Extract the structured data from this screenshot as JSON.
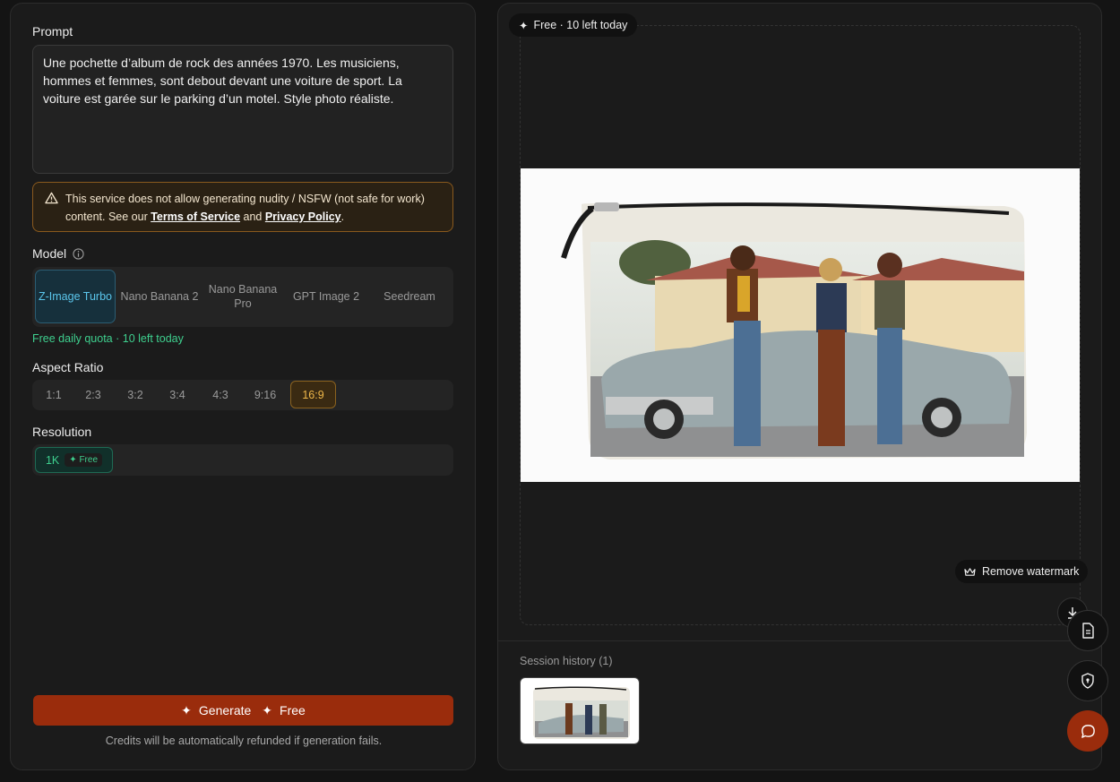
{
  "left": {
    "prompt_label": "Prompt",
    "prompt_value": "Une pochette d’album de rock des années 1970. Les musiciens, hommes et femmes, sont debout devant une voiture de sport. La voiture est garée sur le parking d’un motel. Style photo réaliste.",
    "warning": {
      "text1": "This service does not allow generating nudity / NSFW (not safe for work) content. See our ",
      "tos": "Terms of Service",
      "and": " and ",
      "privacy": "Privacy Policy",
      "end": "."
    },
    "model_label": "Model",
    "models": [
      "Z-Image Turbo",
      "Nano Banana 2",
      "Nano Banana Pro",
      "GPT Image 2",
      "Seedream"
    ],
    "quota": "Free daily quota · 10 left today",
    "aspect_label": "Aspect Ratio",
    "aspects": [
      "1:1",
      "2:3",
      "3:2",
      "3:4",
      "4:3",
      "9:16",
      "16:9"
    ],
    "resolution_label": "Resolution",
    "resolution": "1K",
    "resolution_badge": "Free",
    "generate_label": "Generate",
    "generate_badge": "Free",
    "refund_note": "Credits will be automatically refunded if generation fails."
  },
  "right": {
    "free_pill": "Free · 10 left today",
    "remove_watermark": "Remove watermark",
    "history_label": "Session history (1)"
  },
  "colors": {
    "accent": "#9a2c0c",
    "selected_model": "#5bc6ec",
    "selected_aspect": "#f0b84a",
    "quota": "#3ecf8e"
  }
}
